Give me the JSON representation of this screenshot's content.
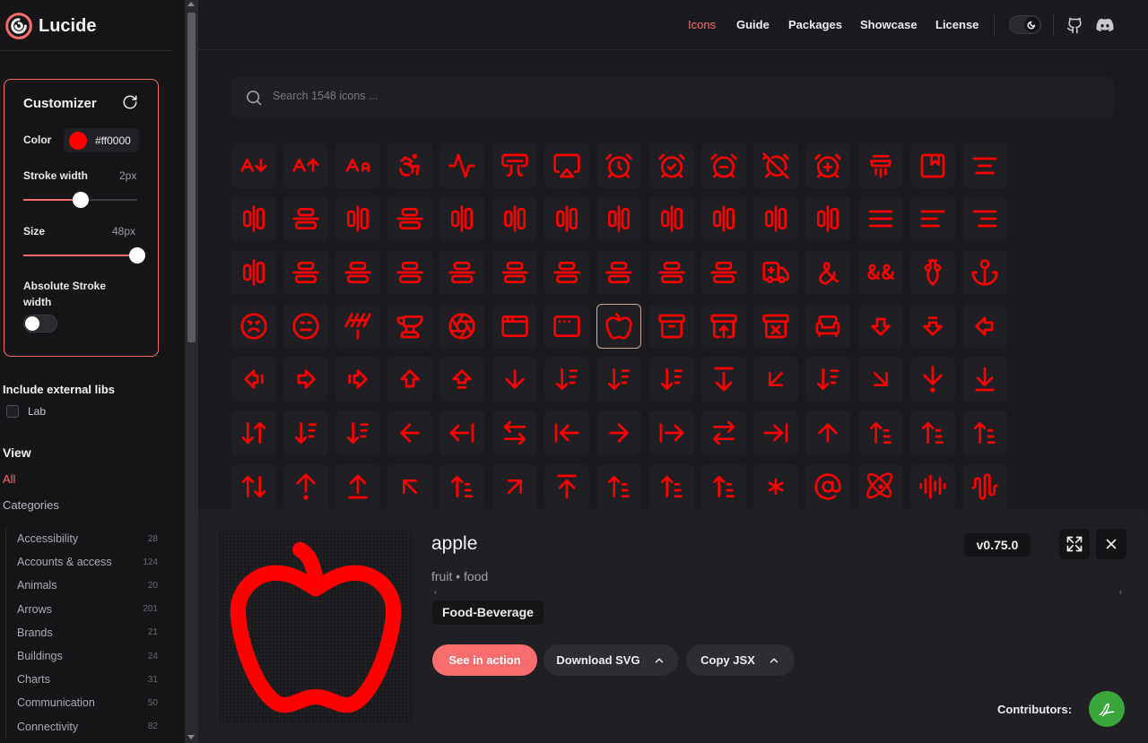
{
  "app": {
    "name": "Lucide"
  },
  "nav": {
    "links": [
      "Icons",
      "Guide",
      "Packages",
      "Showcase",
      "License"
    ],
    "active": "Icons"
  },
  "customizer": {
    "title": "Customizer",
    "color_label": "Color",
    "color_value": "#ff0000",
    "stroke_width_label": "Stroke width",
    "stroke_width_value": "2px",
    "stroke_width_level": 0.5,
    "size_label": "Size",
    "size_value": "48px",
    "size_level": 1.0,
    "absolute_stroke_label": "Absolute Stroke width",
    "absolute_stroke_on": false
  },
  "external_libs": {
    "title": "Include external libs",
    "option": "Lab",
    "checked": false
  },
  "view": {
    "title": "View",
    "all_label": "All",
    "categories_label": "Categories",
    "categories": [
      {
        "name": "Accessibility",
        "count": "28"
      },
      {
        "name": "Accounts & access",
        "count": "124"
      },
      {
        "name": "Animals",
        "count": "20"
      },
      {
        "name": "Arrows",
        "count": "201"
      },
      {
        "name": "Brands",
        "count": "21"
      },
      {
        "name": "Buildings",
        "count": "24"
      },
      {
        "name": "Charts",
        "count": "31"
      },
      {
        "name": "Communication",
        "count": "50"
      },
      {
        "name": "Connectivity",
        "count": "82"
      }
    ]
  },
  "search": {
    "placeholder": "Search 1548 icons ..."
  },
  "icon_color": "#ff0000",
  "accent_color": "#f76c6c",
  "grid": {
    "rows": [
      [
        "a-arrow-down",
        "a-arrow-up",
        "a-large-small",
        "accessibility",
        "activity",
        "air-vent",
        "airplay",
        "alarm-clock",
        "alarm-clock-check",
        "alarm-clock-minus",
        "alarm-clock-off",
        "alarm-clock-plus",
        "alarm-smoke",
        "album",
        "align-center"
      ],
      [
        "align-center-horizontal",
        "align-center-vertical",
        "align-end-horizontal",
        "align-end-vertical",
        "align-horizontal-distribute-center",
        "align-horizontal-distribute-end",
        "align-horizontal-distribute-start",
        "align-horizontal-justify-center",
        "align-horizontal-justify-end",
        "align-horizontal-justify-start",
        "align-horizontal-space-around",
        "align-horizontal-space-between",
        "align-justify",
        "align-left",
        "align-right"
      ],
      [
        "align-start-horizontal",
        "align-start-vertical",
        "align-vertical-distribute-center",
        "align-vertical-distribute-end",
        "align-vertical-distribute-start",
        "align-vertical-justify-center",
        "align-vertical-justify-end",
        "align-vertical-justify-start",
        "align-vertical-space-around",
        "align-vertical-space-between",
        "ambulance",
        "ampersand",
        "ampersands",
        "amphora",
        "anchor"
      ],
      [
        "angry",
        "annoyed",
        "antenna",
        "anvil",
        "aperture",
        "app-window",
        "app-window-mac",
        "apple",
        "archive",
        "archive-restore",
        "archive-x",
        "armchair",
        "arrow-big-down",
        "arrow-big-down-dash",
        "arrow-big-left"
      ],
      [
        "arrow-big-left-dash",
        "arrow-big-right",
        "arrow-big-right-dash",
        "arrow-big-up",
        "arrow-big-up-dash",
        "arrow-down",
        "arrow-down-0-1",
        "arrow-down-1-0",
        "arrow-down-a-z",
        "arrow-down-from-line",
        "arrow-down-left",
        "arrow-down-narrow-wide",
        "arrow-down-right",
        "arrow-down-to-dot",
        "arrow-down-to-line"
      ],
      [
        "arrow-down-up",
        "arrow-down-wide-narrow",
        "arrow-down-z-a",
        "arrow-left",
        "arrow-left-from-line",
        "arrow-left-right",
        "arrow-left-to-line",
        "arrow-right",
        "arrow-right-from-line",
        "arrow-right-left",
        "arrow-right-to-line",
        "arrow-up",
        "arrow-up-0-1",
        "arrow-up-1-0",
        "arrow-up-a-z"
      ],
      [
        "arrow-up-down",
        "arrow-up-from-dot",
        "arrow-up-from-line",
        "arrow-up-left",
        "arrow-up-narrow-wide",
        "arrow-up-right",
        "arrow-up-to-line",
        "arrow-up-wide-narrow",
        "arrow-up-z-a",
        "arrows-up-from-line",
        "asterisk",
        "at-sign",
        "atom",
        "audio-lines",
        "audio-waveform"
      ]
    ],
    "selected": "apple"
  },
  "detail": {
    "name": "apple",
    "tags": "fruit • food",
    "category": "Food-Beverage",
    "version": "v0.75.0",
    "see_in_action": "See in action",
    "download_svg": "Download SVG",
    "copy_jsx": "Copy JSX",
    "contributors_label": "Contributors:"
  }
}
